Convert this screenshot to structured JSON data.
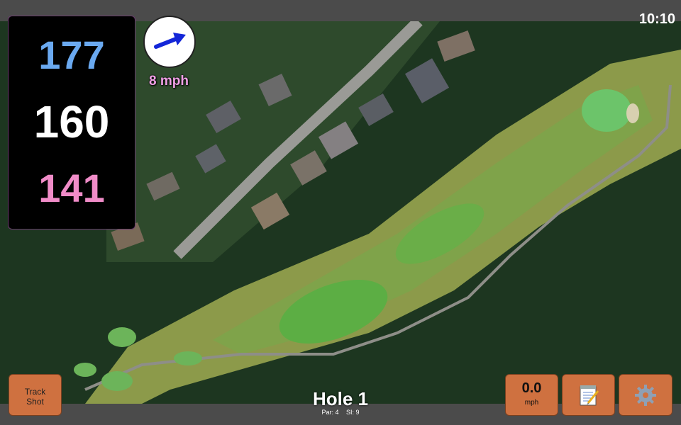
{
  "status": {
    "time": "10:10"
  },
  "distances": {
    "back": "177",
    "middle": "160",
    "front": "141"
  },
  "wind": {
    "speed_label": "8 mph",
    "direction_icon": "arrow-right-up-icon"
  },
  "hole": {
    "title": "Hole 1",
    "par": "Par: 4",
    "si": "SI: 9"
  },
  "buttons": {
    "track_shot_line1": "Track",
    "track_shot_line2": "Shot",
    "speed_value": "0.0",
    "speed_unit": "mph",
    "notes_icon": "notepad-icon",
    "settings_icon": "gear-icon"
  },
  "colors": {
    "back_distance": "#6aa9f0",
    "middle_distance": "#ffffff",
    "front_distance": "#f08cc8",
    "button_bg": "#cf7140",
    "wind_label": "#f0a0e6"
  }
}
